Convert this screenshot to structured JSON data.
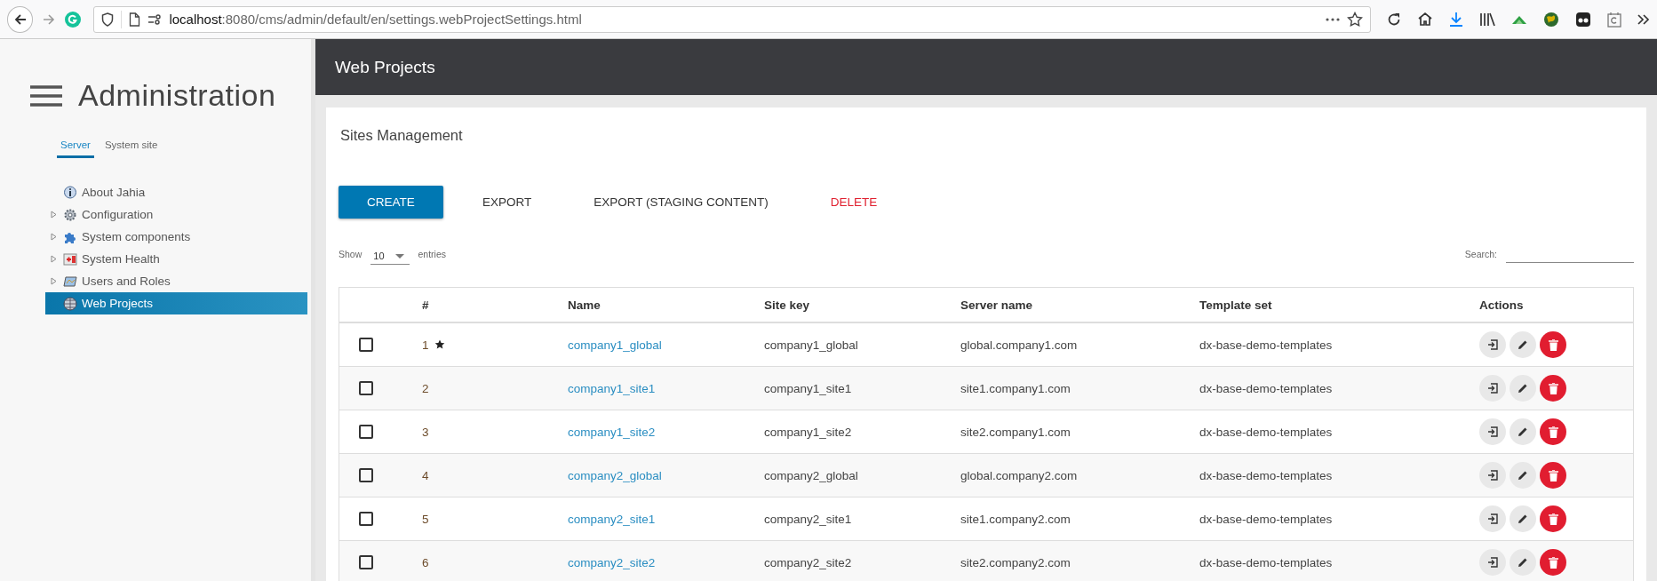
{
  "browser": {
    "url_host": "localhost",
    "url_path": ":8080/cms/admin/default/en/settings.webProjectSettings.html"
  },
  "sidebar": {
    "title": "Administration",
    "tabs": [
      {
        "label": "Server",
        "selected": true
      },
      {
        "label": "System site",
        "selected": false
      }
    ],
    "items": [
      {
        "label": "About Jahia",
        "kind": "info",
        "expandable": false,
        "selected": false
      },
      {
        "label": "Configuration",
        "kind": "gear",
        "expandable": true,
        "expanded": false,
        "selected": false
      },
      {
        "label": "System components",
        "kind": "puzzle",
        "expandable": true,
        "expanded": false,
        "selected": false
      },
      {
        "label": "System Health",
        "kind": "health",
        "expandable": true,
        "expanded": false,
        "selected": false
      },
      {
        "label": "Users and Roles",
        "kind": "users",
        "expandable": true,
        "expanded": false,
        "selected": false
      },
      {
        "label": "Web Projects",
        "kind": "globe",
        "expandable": false,
        "selected": true
      }
    ]
  },
  "header": {
    "title": "Web Projects"
  },
  "card": {
    "title": "Sites Management",
    "actions": [
      {
        "label": "CREATE",
        "kind": "primary"
      },
      {
        "label": "EXPORT",
        "kind": "flat"
      },
      {
        "label": "EXPORT (STAGING CONTENT)",
        "kind": "flat"
      },
      {
        "label": "DELETE",
        "kind": "danger"
      }
    ],
    "show_label": "Show",
    "page_size": "10",
    "entries_label": "entries",
    "search_label": "Search:",
    "table": {
      "columns": [
        "#",
        "Name",
        "Site key",
        "Server name",
        "Template set",
        "Actions"
      ],
      "rows": [
        {
          "checked": false,
          "number": "1",
          "default": true,
          "name": "company1_global",
          "site_key": "company1_global",
          "server_name": "global.company1.com",
          "template_set": "dx-base-demo-templates"
        },
        {
          "checked": false,
          "number": "2",
          "default": false,
          "name": "company1_site1",
          "site_key": "company1_site1",
          "server_name": "site1.company1.com",
          "template_set": "dx-base-demo-templates"
        },
        {
          "checked": false,
          "number": "3",
          "default": false,
          "name": "company1_site2",
          "site_key": "company1_site2",
          "server_name": "site2.company1.com",
          "template_set": "dx-base-demo-templates"
        },
        {
          "checked": false,
          "number": "4",
          "default": false,
          "name": "company2_global",
          "site_key": "company2_global",
          "server_name": "global.company2.com",
          "template_set": "dx-base-demo-templates"
        },
        {
          "checked": false,
          "number": "5",
          "default": false,
          "name": "company2_site1",
          "site_key": "company2_site1",
          "server_name": "site1.company2.com",
          "template_set": "dx-base-demo-templates"
        },
        {
          "checked": false,
          "number": "6",
          "default": false,
          "name": "company2_site2",
          "site_key": "company2_site2",
          "server_name": "site2.company2.com",
          "template_set": "dx-base-demo-templates"
        }
      ]
    }
  }
}
